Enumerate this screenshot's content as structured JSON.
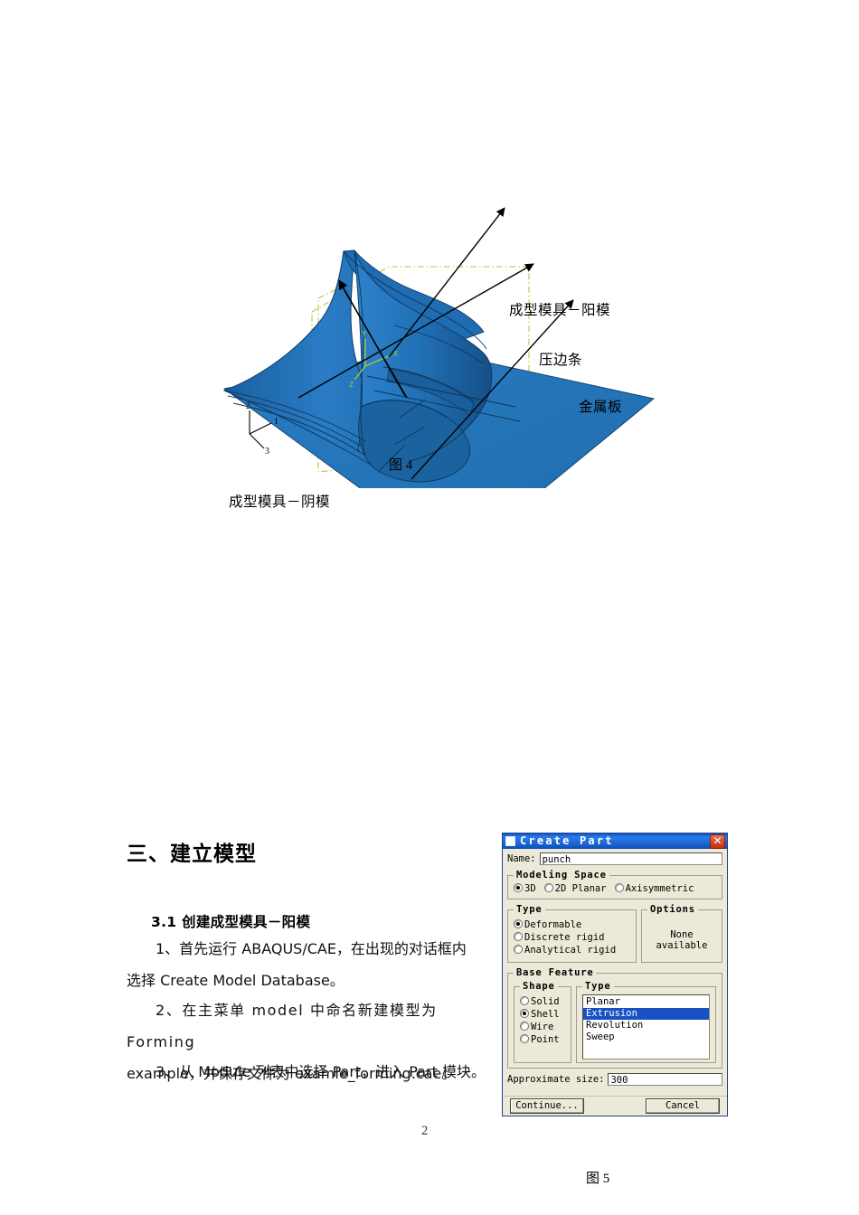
{
  "figure4": {
    "caption": "图 4",
    "callouts": {
      "punch": "成型模具－阳模",
      "binder": "压边条",
      "sheet": "金属板",
      "die": "成型模具－阴模"
    },
    "triad_model": {
      "y": "Y",
      "x": "X",
      "z": "Z"
    },
    "triad_global": {
      "a2": "2",
      "a1": "1",
      "a3": "3"
    },
    "colors": {
      "surface_light": "#2e7ec4",
      "surface_mid": "#1f6fb8",
      "surface_dark": "#17548f",
      "sheet": "#2278bd",
      "datum": "#c8c84a",
      "triad": "#a8c83c"
    }
  },
  "document": {
    "heading": "三、建立模型",
    "subheading": "3.1 创建成型模具－阳模",
    "paragraphs": {
      "p1_a": "1、首先运行 ABAQUS/CAE，在出现的对话框内",
      "p1_b": "选择 Create Model Database。",
      "p2_a": "2、在主菜单 model 中命名新建模型为 Forming",
      "p2_b": "example，并保存文件为 examle_forming.cae。",
      "p3": "3、从 Module 列表中选择 Part，进入 Part 模块。"
    },
    "page_number": "2"
  },
  "figure5": {
    "caption": "图 5",
    "dialog": {
      "title": "Create Part",
      "close_label": "✕",
      "name_label": "Name:",
      "name_value": "punch",
      "modeling_space": {
        "legend": "Modeling Space",
        "options": [
          {
            "label": "3D",
            "selected": true
          },
          {
            "label": "2D Planar",
            "selected": false
          },
          {
            "label": "Axisymmetric",
            "selected": false
          }
        ]
      },
      "type": {
        "legend": "Type",
        "options": [
          {
            "label": "Deformable",
            "selected": true
          },
          {
            "label": "Discrete rigid",
            "selected": false
          },
          {
            "label": "Analytical rigid",
            "selected": false
          }
        ]
      },
      "options": {
        "legend": "Options",
        "text": "None available"
      },
      "base_feature": {
        "legend": "Base Feature",
        "shape": {
          "legend": "Shape",
          "options": [
            {
              "label": "Solid",
              "selected": false
            },
            {
              "label": "Shell",
              "selected": true
            },
            {
              "label": "Wire",
              "selected": false
            },
            {
              "label": "Point",
              "selected": false
            }
          ]
        },
        "type": {
          "legend": "Type",
          "items": [
            {
              "label": "Planar",
              "selected": false
            },
            {
              "label": "Extrusion",
              "selected": true
            },
            {
              "label": "Revolution",
              "selected": false
            },
            {
              "label": "Sweep",
              "selected": false
            }
          ]
        }
      },
      "approx_size_label": "Approximate size:",
      "approx_size_value": "300",
      "continue_label": "Continue...",
      "cancel_label": "Cancel",
      "colors": {
        "titlebar": "#1e6bdc",
        "face": "#ece9d8",
        "selection": "#1851c4",
        "close": "#c43018"
      }
    }
  }
}
